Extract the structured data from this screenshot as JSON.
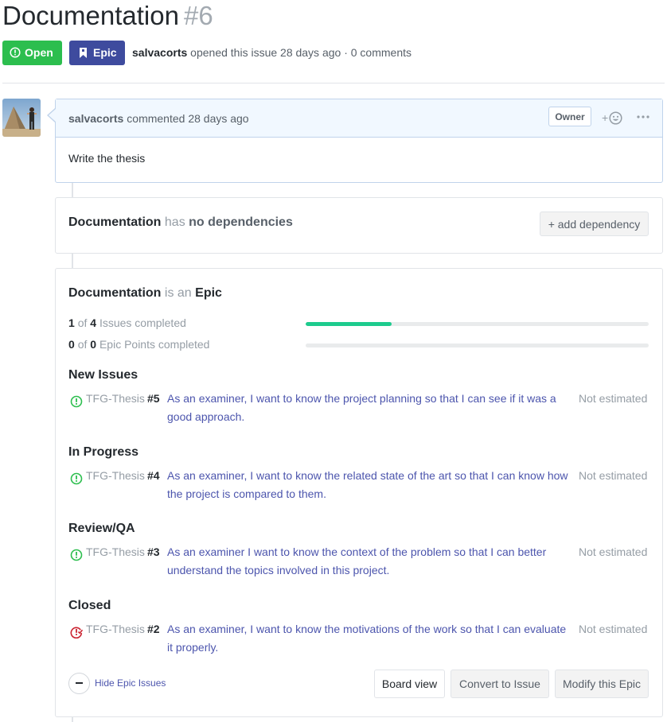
{
  "issue": {
    "title": "Documentation",
    "number": "#6",
    "state_label": "Open",
    "type_label": "Epic",
    "author": "salvacorts",
    "opened_text": "opened this issue 28 days ago · 0 comments"
  },
  "comment": {
    "author": "salvacorts",
    "meta": "commented 28 days ago",
    "owner_label": "Owner",
    "react_label": "+",
    "body": "Write the thesis"
  },
  "dependencies": {
    "subject": "Documentation",
    "has": "has",
    "status": "no dependencies",
    "add_button": "+ add dependency"
  },
  "epic": {
    "subject": "Documentation",
    "is_an": "is an",
    "kind": "Epic",
    "issues_done": "1",
    "issues_of": "of",
    "issues_total": "4",
    "issues_label": "Issues completed",
    "issues_progress": 0.25,
    "points_done": "0",
    "points_of": "of",
    "points_total": "0",
    "points_label": "Epic Points completed",
    "points_progress": 0,
    "groups": [
      {
        "name": "New Issues",
        "issues": [
          {
            "repo": "TFG-Thesis",
            "number": "#5",
            "title": "As an examiner, I want to know the project planning so that I can see if it was a good approach.",
            "estimate": "Not estimated",
            "state": "open"
          }
        ]
      },
      {
        "name": "In Progress",
        "issues": [
          {
            "repo": "TFG-Thesis",
            "number": "#4",
            "title": "As an examiner, I want to know the related state of the art so that I can know how the project is compared to them.",
            "estimate": "Not estimated",
            "state": "open"
          }
        ]
      },
      {
        "name": "Review/QA",
        "issues": [
          {
            "repo": "TFG-Thesis",
            "number": "#3",
            "title": "As an examiner I want to know the context of the problem so that I can better understand the topics involved in this project.",
            "estimate": "Not estimated",
            "state": "open"
          }
        ]
      },
      {
        "name": "Closed",
        "issues": [
          {
            "repo": "TFG-Thesis",
            "number": "#2",
            "title": "As an examiner, I want to know the motivations of the work so that I can evaluate it properly.",
            "estimate": "Not estimated",
            "state": "closed"
          }
        ]
      }
    ],
    "hide_label": "Hide Epic Issues",
    "board_view": "Board view",
    "convert": "Convert to Issue",
    "modify": "Modify this Epic"
  },
  "colors": {
    "open_green": "#2cbe4e",
    "epic_indigo": "#3e4b9e",
    "link": "#4c55ad",
    "progress": "#1dcb8d",
    "closed_red": "#cb2431"
  },
  "icons": [
    "issue-opened-icon",
    "bookmark-icon",
    "smiley-icon",
    "kebab-icon",
    "issue-closed-icon",
    "minus-icon"
  ]
}
